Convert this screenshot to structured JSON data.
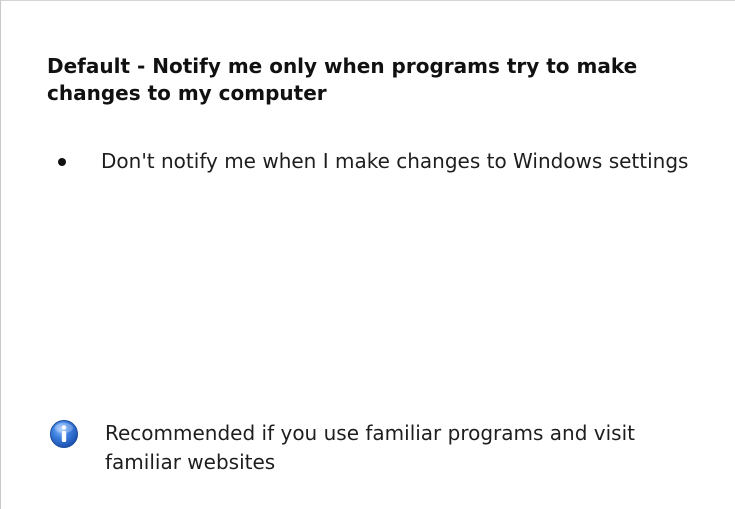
{
  "uac_setting": {
    "title": "Default - Notify me only when programs try to make changes to my computer",
    "bullets": [
      "Don't notify me when I make changes to Windows settings"
    ],
    "recommendation": {
      "icon": "info-icon",
      "text": "Recommended if you use familiar programs and visit familiar websites"
    }
  },
  "colors": {
    "info_icon": "#2f6fd6",
    "text": "#1e1e1e",
    "border": "#c8c8c8"
  }
}
